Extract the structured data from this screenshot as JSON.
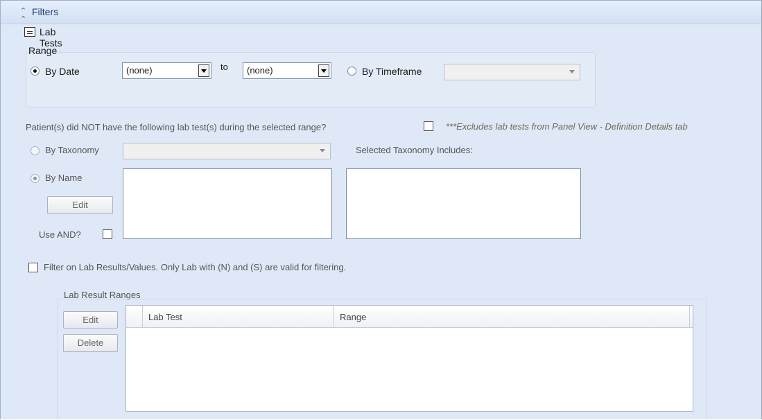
{
  "header": {
    "title": "Filters",
    "collapse_icon": "double-chevron-up-icon"
  },
  "lab_tests": {
    "title": "Lab Tests",
    "toggle_icon": "collapse-box-icon",
    "range": {
      "label": "Range",
      "by_date_label": "By Date",
      "by_date_selected": true,
      "from_value": "(none)",
      "to_label": "to",
      "to_value": "(none)",
      "by_timeframe_label": "By Timeframe",
      "by_timeframe_selected": false,
      "timeframe_value": ""
    },
    "not_have_question": "Patient(s) did NOT have the following lab test(s) during the selected range?",
    "not_have_checked": false,
    "note": "***Excludes lab tests from Panel View - Definition Details tab",
    "by_taxonomy_label": "By Taxonomy",
    "taxonomy_value": "",
    "selected_taxonomy_label": "Selected Taxonomy Includes:",
    "by_name_label": "By Name",
    "by_name_selected": true,
    "edit_label": "Edit",
    "use_and_label": "Use AND?",
    "use_and_checked": false,
    "filter_results_label": "Filter on Lab Results/Values.  Only Lab with (N) and (S) are valid for filtering.",
    "filter_results_checked": false,
    "result_ranges": {
      "label": "Lab Result Ranges",
      "edit_label": "Edit",
      "delete_label": "Delete",
      "columns": [
        "Lab Test",
        "Range"
      ],
      "rows": []
    }
  }
}
